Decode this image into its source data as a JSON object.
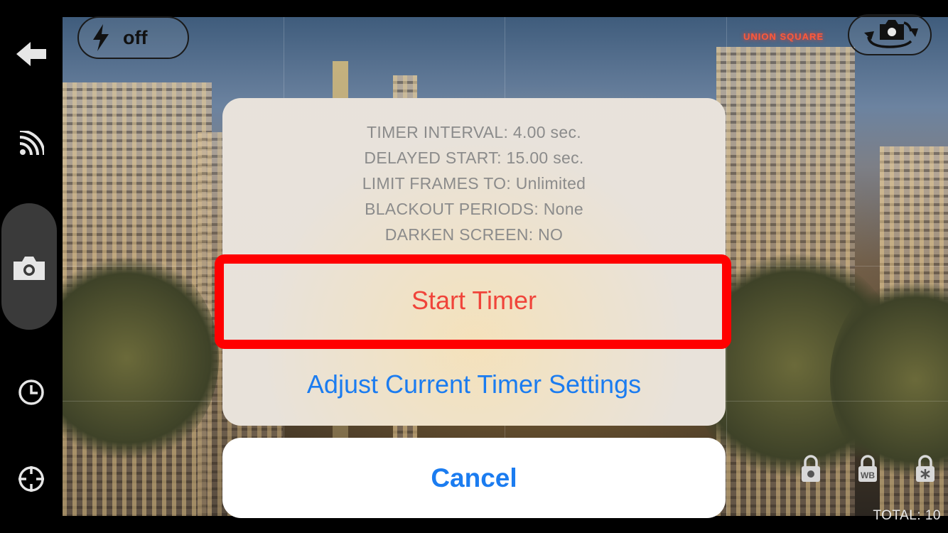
{
  "flash": {
    "label": "off",
    "icon": "lightning-bolt-icon"
  },
  "rail": {
    "icons": [
      "back-arrow-icon",
      "wifi-remote-icon",
      "camera-icon",
      "clock-icon",
      "crosshair-icon"
    ]
  },
  "viewfinder": {
    "sign_text": "UNION SQUARE",
    "total": "TOTAL: 10"
  },
  "locks": [
    "exposure-lock-icon",
    "white-balance-lock-icon",
    "focus-lock-icon"
  ],
  "lock_labels": {
    "wb": "WB"
  },
  "sheet": {
    "lines": [
      "TIMER INTERVAL: 4.00 sec.",
      "DELAYED START: 15.00 sec.",
      "LIMIT FRAMES TO: Unlimited",
      "BLACKOUT PERIODS: None",
      "DARKEN SCREEN: NO"
    ],
    "start_label": "Start Timer",
    "adjust_label": "Adjust Current Timer Settings",
    "cancel_label": "Cancel"
  },
  "colors": {
    "destructive": "#f0443a",
    "action": "#1b7cf0",
    "highlight": "#ff0000"
  }
}
